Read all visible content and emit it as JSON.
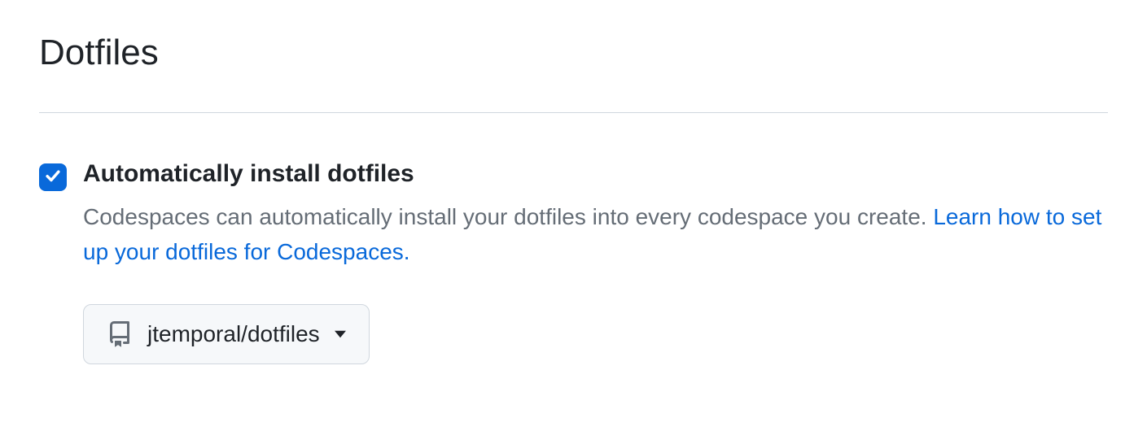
{
  "page": {
    "title": "Dotfiles"
  },
  "setting": {
    "checked": true,
    "label": "Automatically install dotfiles",
    "description": "Codespaces can automatically install your dotfiles into every codespace you create. ",
    "link_text": "Learn how to set up your dotfiles for Codespaces."
  },
  "selector": {
    "selected_repo": "jtemporal/dotfiles"
  }
}
